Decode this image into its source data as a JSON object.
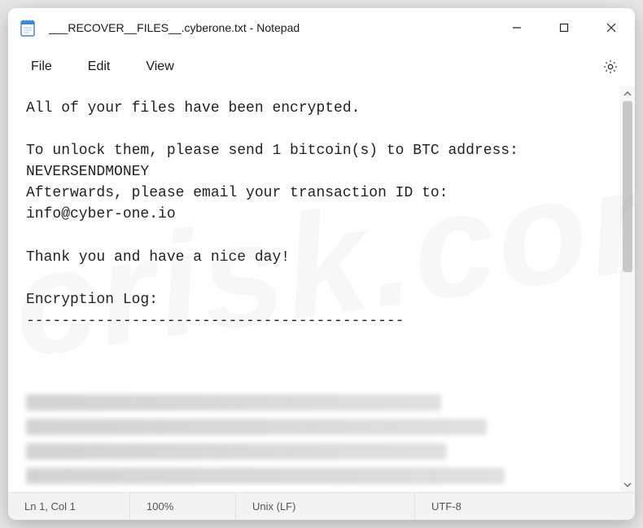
{
  "window": {
    "title": "___RECOVER__FILES__.cyberone.txt - Notepad"
  },
  "menu": {
    "file": "File",
    "edit": "Edit",
    "view": "View"
  },
  "document": {
    "body": "All of your files have been encrypted.\n\nTo unlock them, please send 1 bitcoin(s) to BTC address:\nNEVERSENDMONEY\nAfterwards, please email your transaction ID to:\ninfo@cyber-one.io\n\nThank you and have a nice day!\n\nEncryption Log:\n-------------------------------------------"
  },
  "status": {
    "cursor": "Ln 1, Col 1",
    "zoom": "100%",
    "line_endings": "Unix (LF)",
    "encoding": "UTF-8"
  },
  "watermark": "pcrisk.com"
}
